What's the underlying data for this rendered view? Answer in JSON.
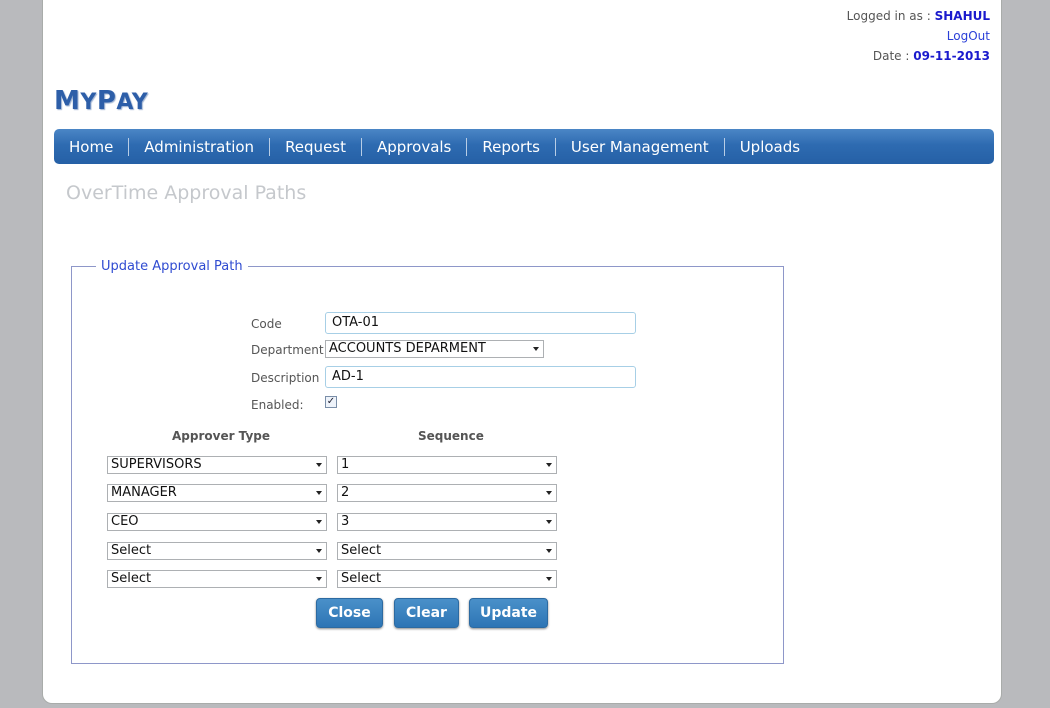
{
  "header": {
    "logged_in_label": "Logged in as :",
    "username": "SHAHUL",
    "logout": "LogOut",
    "date_label": "Date :",
    "date": "09-11-2013"
  },
  "logo": {
    "first_big": "M",
    "first_rest": "Y",
    "second_big": "P",
    "second_rest": "AY"
  },
  "nav": [
    "Home",
    "Administration",
    "Request",
    "Approvals",
    "Reports",
    "User Management",
    "Uploads"
  ],
  "page_title": "OverTime Approval Paths",
  "form": {
    "legend": "Update Approval Path",
    "code_label": "Code",
    "code_value": "OTA-01",
    "department_label": "Department",
    "department_value": "ACCOUNTS DEPARMENT",
    "description_label": "Description",
    "description_value": "AD-1",
    "enabled_label": "Enabled:",
    "enabled_checked": true,
    "approver_type_header": "Approver Type",
    "sequence_header": "Sequence",
    "rows": [
      {
        "approver": "SUPERVISORS",
        "sequence": "1"
      },
      {
        "approver": "MANAGER",
        "sequence": "2"
      },
      {
        "approver": "CEO",
        "sequence": "3"
      },
      {
        "approver": "Select",
        "sequence": "Select"
      },
      {
        "approver": "Select",
        "sequence": "Select"
      }
    ]
  },
  "buttons": {
    "close": "Close",
    "clear": "Clear",
    "update": "Update"
  },
  "colors": {
    "nav": "#2e6bb1",
    "accent_blue": "#1a1acd",
    "button": "#2d75b5"
  }
}
